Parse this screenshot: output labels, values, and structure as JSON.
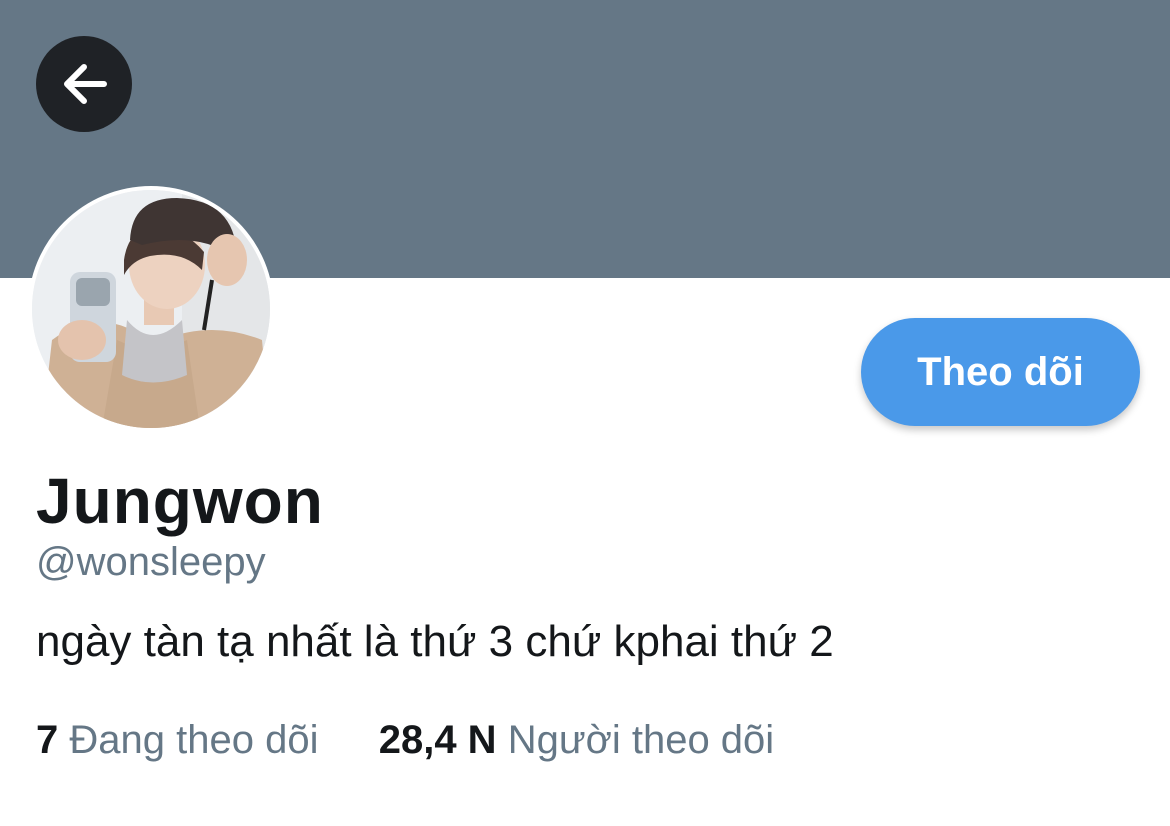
{
  "header": {
    "banner_color": "#657786",
    "back_icon": "arrow-left-icon"
  },
  "profile": {
    "display_name": "Jungwon",
    "handle": "@wonsleepy",
    "bio": "ngày tàn tạ nhất là thứ 3 chứ kphai thứ 2",
    "follow_label": "Theo dõi",
    "accent_color": "#4a99e9"
  },
  "stats": {
    "following_count": "7",
    "following_label": "Đang theo dõi",
    "followers_count": "28,4 N",
    "followers_label": "Người theo dõi"
  }
}
